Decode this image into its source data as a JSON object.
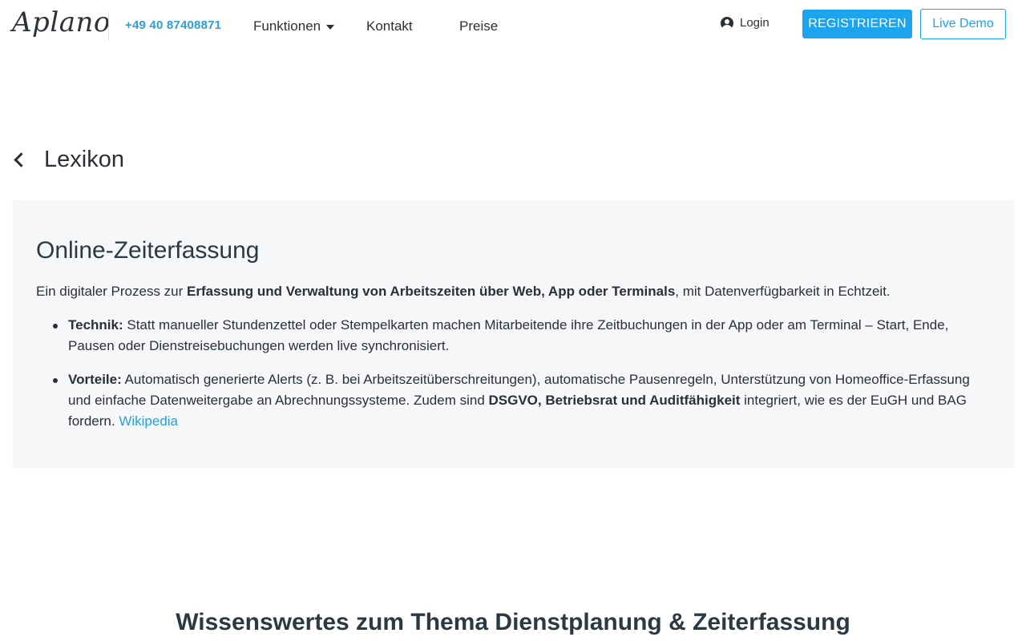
{
  "header": {
    "logo": "Aplano",
    "phone": "+49 40 87408871",
    "nav": {
      "funktionen": "Funktionen",
      "kontakt": "Kontakt",
      "preise": "Preise"
    },
    "login": "Login",
    "register": "REGISTRIEREN",
    "demo": "Live Demo"
  },
  "back": {
    "label": "Lexikon"
  },
  "card": {
    "title": "Online-Zeiterfassung",
    "intro_pre": "Ein digitaler Prozess zur ",
    "intro_bold": "Erfassung und Verwaltung von Arbeitszeiten über Web, App oder Terminals",
    "intro_post": ", mit Datenverfügbarkeit in Echtzeit.",
    "bullets": [
      {
        "term": "Technik:",
        "text": " Statt manueller Stundenzettel oder Stempelkarten machen Mitarbeitende ihre Zeitbuchungen in der App oder am Terminal – Start, Ende, Pausen oder Dienstreisebuchungen werden live synchronisiert."
      },
      {
        "term": "Vorteile:",
        "text_pre": " Automatisch generierte Alerts (z. B. bei Arbeitszeitüberschreitungen), automatische Pausenregeln, Unterstützung von Homeoffice-Erfassung und einfache Datenweitergabe an Abrechnungssysteme. Zudem sind ",
        "bold": "DSGVO, Betriebsrat und Auditfähigkeit",
        "text_post": " integriert, wie es der EuGH und BAG fordern. ",
        "link": "Wikipedia"
      }
    ]
  },
  "section_heading": "Wissenswertes zum Thema Dienstplanung & Zeiterfassung",
  "colors": {
    "accent": "#1ca4ee",
    "link": "#2a9fd8",
    "card_bg": "#f6f7f8",
    "text": "#2b2f36"
  }
}
